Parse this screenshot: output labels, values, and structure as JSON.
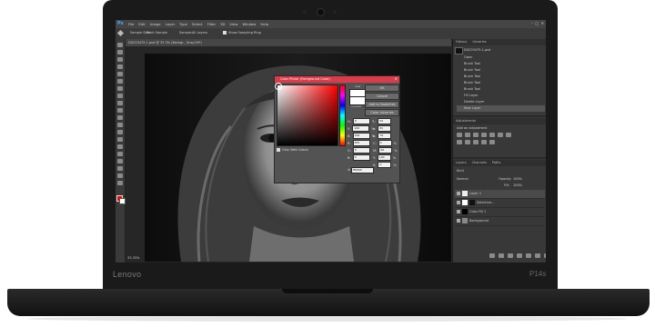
{
  "device": {
    "brand": "Lenovo",
    "model": "P14s"
  },
  "photoshop": {
    "app_icon": "Ps",
    "menu": [
      "File",
      "Edit",
      "Image",
      "Layer",
      "Type",
      "Select",
      "Filter",
      "3D",
      "View",
      "Window",
      "Help"
    ],
    "options": {
      "sample_size_label": "Sample Size:",
      "sample_size_value": "Point Sample",
      "sample_label": "Sample:",
      "sample_value": "All Layers",
      "show_ring_label": "Show Sampling Ring"
    },
    "document_tab": "DSC03475.1.psd @ 33.3% (Backgr., Gray/16*)",
    "status_bar": "33.33%",
    "color_picker": {
      "title": "Color Picker (Foreground Color)",
      "buttons": {
        "ok": "OK",
        "cancel": "Cancel",
        "add_swatches": "Add to Swatches",
        "libraries": "Color Libraries"
      },
      "new_label": "new",
      "current_label": "current",
      "only_web": "Only Web Colors",
      "fields_left": [
        {
          "label": "H:",
          "value": "0",
          "unit": "°"
        },
        {
          "label": "S:",
          "value": "100",
          "unit": "%"
        },
        {
          "label": "B:",
          "value": "100",
          "unit": "%"
        },
        {
          "label": "R:",
          "value": "255",
          "unit": ""
        },
        {
          "label": "G:",
          "value": "0",
          "unit": ""
        },
        {
          "label": "B:",
          "value": "0",
          "unit": ""
        }
      ],
      "fields_right": [
        {
          "label": "L:",
          "value": "54"
        },
        {
          "label": "a:",
          "value": "81"
        },
        {
          "label": "b:",
          "value": "70"
        },
        {
          "label": "C:",
          "value": "0",
          "unit": "%"
        },
        {
          "label": "M:",
          "value": "99",
          "unit": "%"
        },
        {
          "label": "Y:",
          "value": "100",
          "unit": "%"
        },
        {
          "label": "K:",
          "value": "0",
          "unit": "%"
        }
      ],
      "hex_label": "#",
      "hex_value": "ff0000"
    },
    "panels": {
      "top_tabs": [
        "History",
        "Libraries"
      ],
      "history_doc": "DSC03475.1.psd",
      "history_items": [
        "Open",
        "Brush Tool",
        "Brush Tool",
        "Brush Tool",
        "Brush Tool",
        "Brush Tool",
        "Fill Layer",
        "Delete Layer",
        "New Layer"
      ],
      "adjust_tab": "Adjustments",
      "adjust_title": "Add an adjustment",
      "layers_tabs": [
        "Layers",
        "Channels",
        "Paths"
      ],
      "layers_kind": "Kind",
      "layers_mode": "Normal",
      "opacity_label": "Opacity:",
      "opacity_value": "100%",
      "fill_label": "Fill:",
      "fill_value": "100%",
      "layers": [
        "Layer 1",
        "Selective...",
        "Color Fill 1",
        "Background"
      ]
    }
  }
}
